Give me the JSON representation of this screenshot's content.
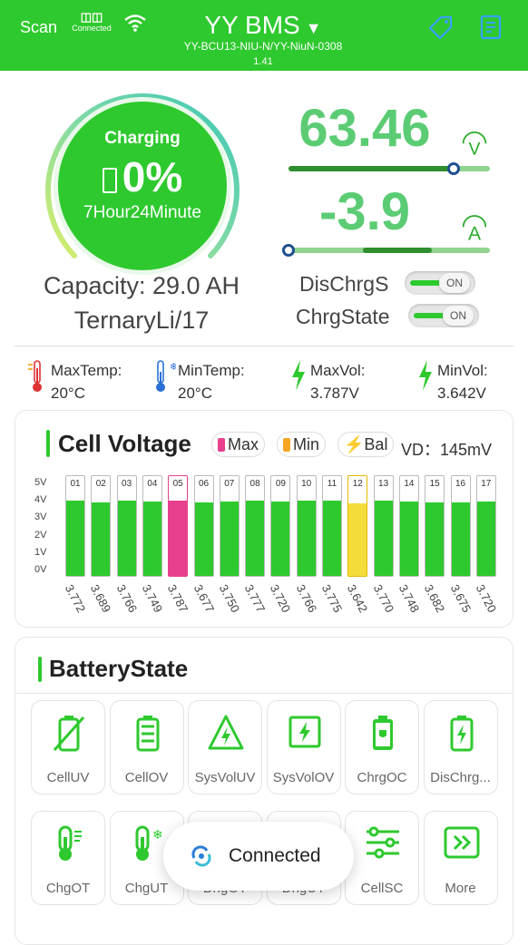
{
  "header": {
    "scan_label": "Scan",
    "connection_label": "Connected",
    "title": "YY BMS",
    "device_name": "YY-BCU13-NIU-N/YY-NiuN-0308",
    "version": "1.41",
    "accent_color": "#2ec92e"
  },
  "gauge": {
    "status": "Charging",
    "percent_text": "0%",
    "time_left": "7Hour24Minute",
    "soc_fraction": 0.0
  },
  "capacity": "Capacity: 29.0 AH",
  "battery_type": "TernaryLi/17",
  "voltage": {
    "value": "63.46",
    "unit": "V",
    "slider_fraction": 0.82
  },
  "current": {
    "value": "-3.9",
    "unit": "A",
    "slider_fraction": 0.0
  },
  "switches": [
    {
      "label": "DisChrgS",
      "state": "ON"
    },
    {
      "label": "ChrgState",
      "state": "ON"
    }
  ],
  "stats": [
    {
      "label": "MaxTemp:",
      "value": "20°C",
      "icon": "thermometer-hot-icon"
    },
    {
      "label": "MinTemp:",
      "value": "20°C",
      "icon": "thermometer-cold-icon"
    },
    {
      "label": "MaxVol:",
      "value": "3.787V",
      "icon": "bolt-icon"
    },
    {
      "label": "MinVol:",
      "value": "3.642V",
      "icon": "bolt-icon"
    }
  ],
  "cell_voltage": {
    "title": "Cell Voltage",
    "legend": {
      "max": "Max",
      "min": "Min",
      "bal": "Bal"
    },
    "vd_label": "VD：",
    "vd_value": "145mV",
    "y_ticks": [
      "5V",
      "4V",
      "3V",
      "2V",
      "1V",
      "0V"
    ],
    "colors": {
      "normal": "#2ec92e",
      "max": "#e8408f",
      "min": "#f4dc3a",
      "bal": "#f6a623"
    },
    "cells": [
      {
        "no": "01",
        "v": "3.772"
      },
      {
        "no": "02",
        "v": "3.689"
      },
      {
        "no": "03",
        "v": "3.766"
      },
      {
        "no": "04",
        "v": "3.749"
      },
      {
        "no": "05",
        "v": "3.787"
      },
      {
        "no": "06",
        "v": "3.677"
      },
      {
        "no": "07",
        "v": "3.750"
      },
      {
        "no": "08",
        "v": "3.777"
      },
      {
        "no": "09",
        "v": "3.720"
      },
      {
        "no": "10",
        "v": "3.766"
      },
      {
        "no": "11",
        "v": "3.775"
      },
      {
        "no": "12",
        "v": "3.642"
      },
      {
        "no": "13",
        "v": "3.770"
      },
      {
        "no": "14",
        "v": "3.748"
      },
      {
        "no": "15",
        "v": "3.682"
      },
      {
        "no": "16",
        "v": "3.675"
      },
      {
        "no": "17",
        "v": "3.720"
      }
    ]
  },
  "battery_state": {
    "title": "BatteryState",
    "tiles": [
      {
        "label": "CellUV",
        "icon": "battery-slash-icon"
      },
      {
        "label": "CellOV",
        "icon": "battery-full-icon"
      },
      {
        "label": "SysVolUV",
        "icon": "warning-bolt-icon"
      },
      {
        "label": "SysVolOV",
        "icon": "square-bolt-icon"
      },
      {
        "label": "ChrgOC",
        "icon": "battery-plug-icon"
      },
      {
        "label": "DisChrg...",
        "icon": "battery-bolt-icon"
      },
      {
        "label": "ChgOT",
        "icon": "thermometer-icon"
      },
      {
        "label": "ChgUT",
        "icon": "thermometer-snow-icon"
      },
      {
        "label": "DhgOT",
        "icon": "thermometer-icon"
      },
      {
        "label": "DhgUT",
        "icon": "thermometer-snow-icon"
      },
      {
        "label": "CellSC",
        "icon": "sliders-icon"
      },
      {
        "label": "More",
        "icon": "double-chevron-right-icon"
      }
    ]
  },
  "toast": "Connected"
}
